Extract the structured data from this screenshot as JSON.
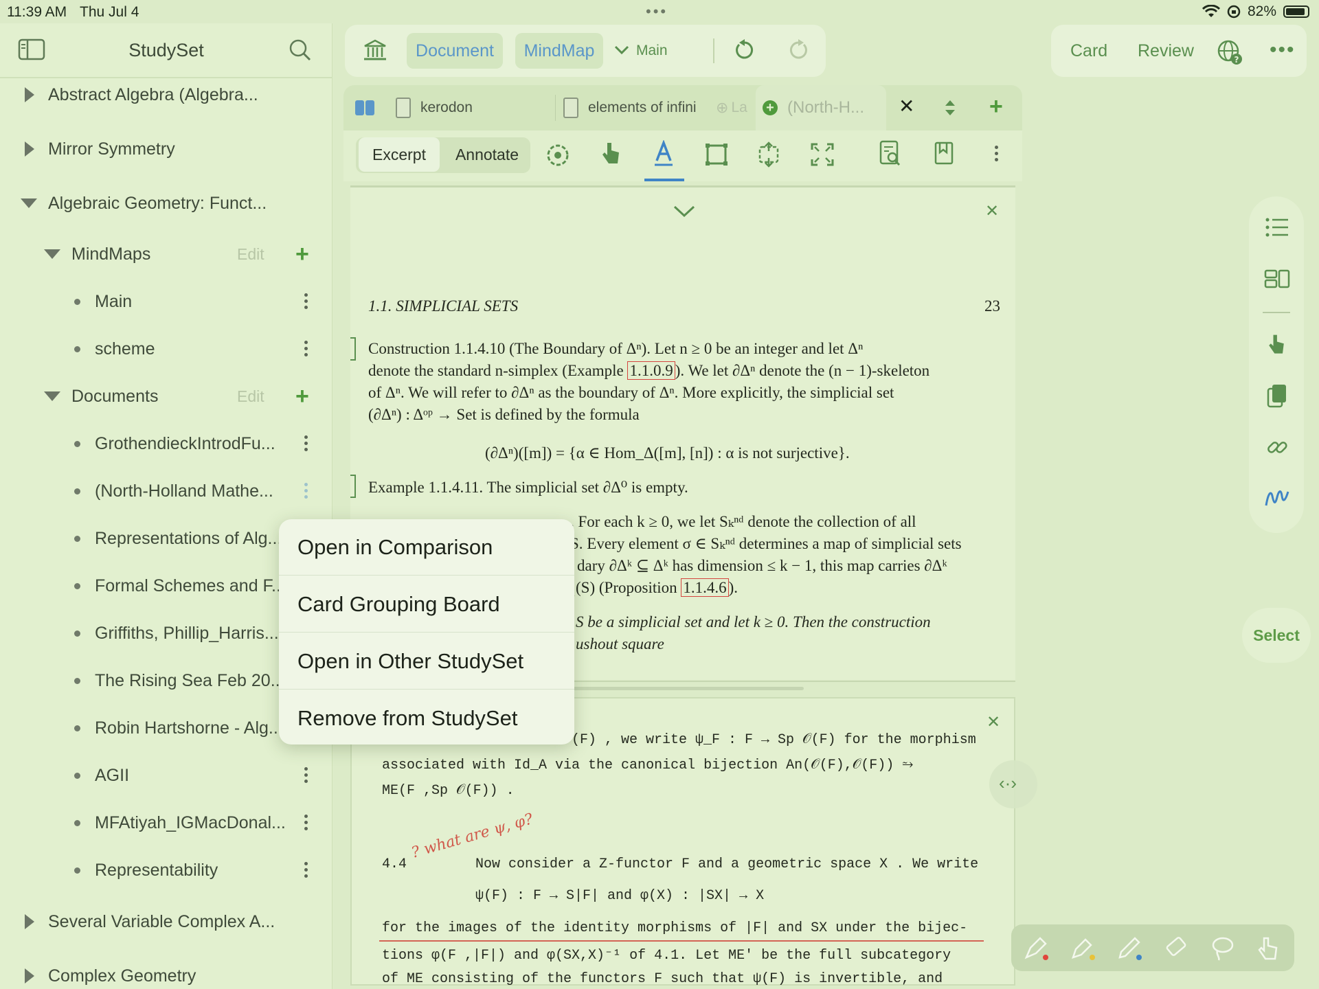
{
  "status": {
    "time": "11:39 AM",
    "date": "Thu Jul 4",
    "battery": "82%"
  },
  "sidebar": {
    "title": "StudySet",
    "items": [
      {
        "label": "Abstract Algebra (Algebra..."
      },
      {
        "label": "Mirror Symmetry"
      },
      {
        "label": "Algebraic Geometry: Funct..."
      },
      {
        "label": "MindMaps",
        "edit": "Edit"
      },
      {
        "label": "Main"
      },
      {
        "label": "scheme"
      },
      {
        "label": "Documents",
        "edit": "Edit"
      },
      {
        "label": "GrothendieckIntrodFu..."
      },
      {
        "label": "(North-Holland Mathe..."
      },
      {
        "label": "Representations of Alg..."
      },
      {
        "label": "Formal Schemes and F..."
      },
      {
        "label": "Griffiths, Phillip_Harris..."
      },
      {
        "label": "The Rising Sea Feb 20..."
      },
      {
        "label": "Robin Hartshorne - Alg..."
      },
      {
        "label": "AGII"
      },
      {
        "label": "MFAtiyah_IGMacDonal..."
      },
      {
        "label": "Representability"
      },
      {
        "label": "Several Variable Complex A..."
      },
      {
        "label": "Complex Geometry"
      }
    ]
  },
  "toolbar": {
    "document": "Document",
    "mindmap": "MindMap",
    "main": "Main"
  },
  "topright": {
    "card": "Card",
    "review": "Review"
  },
  "tabs": [
    {
      "label": "kerodon"
    },
    {
      "label": "elements of infini"
    },
    {
      "label": "La"
    },
    {
      "label": "(North-H..."
    }
  ],
  "modes": {
    "excerpt": "Excerpt",
    "annotate": "Annotate"
  },
  "page1": {
    "header_left": "1.1.   SIMPLICIAL SETS",
    "header_right": "23",
    "lines": [
      "Construction 1.1.4.10 (The Boundary of Δⁿ). Let n ≥ 0 be an integer and let Δⁿ",
      "denote the standard n-simplex (Example ",
      "1.1.0.9",
      "). We let ∂Δⁿ denote the (n − 1)-skeleton",
      "of Δⁿ.  We will refer to ∂Δⁿ as the boundary of Δⁿ.  More explicitly, the simplicial set",
      "(∂Δⁿ) : Δᵒᵖ → Set is defined by the formula",
      "(∂Δⁿ)([m]) = {α ∈ Hom_Δ([m], [n]) : α is not surjective}.",
      "Example 1.1.4.11. The simplicial set ∂Δ⁰ is empty.",
      ".  For each k ≥ 0, we let Sₖⁿᵈ denote the collection of all",
      "S. Every element σ ∈ Sₖⁿᵈ determines a map of simplicial sets",
      "dary ∂Δᵏ ⊆ Δᵏ has dimension ≤ k − 1, this map carries ∂Δᵏ",
      "₁(S) (Proposition ",
      "1.1.4.6",
      ").",
      "S be a simplicial set and let k ≥ 0.  Then the construction",
      "ushout square"
    ]
  },
  "page2": {
    "lines": [
      "(F) , we write  ψ_F : F → Sp 𝒪(F)  for the morphism",
      "associated with  Id_A  via the canonical bijection  An(𝒪(F),𝒪(F)) ⥲",
      "ME(F ,Sp 𝒪(F)) .",
      "4.4",
      "Now consider a Z-functor  F  and a geometric space  X . We write",
      "ψ(F) : F → S|F|  and  φ(X) : |SX| → X",
      "for the images of the identity morphisms of  |F|  and  SX  under the bijec-",
      "tions  φ(F ,|F|)  and  φ(SX,X)⁻¹  of 4.1. Let  ME'  be the full subcategory",
      "of  ME  consisting of the functors  F  such that  ψ(F)  is invertible, and"
    ],
    "handwriting": "? what are ψ, φ?"
  },
  "context_menu": {
    "items": [
      "Open in Comparison",
      "Card Grouping Board",
      "Open in Other StudySet",
      "Remove from StudySet"
    ]
  },
  "right_rail": {
    "select": "Select"
  }
}
